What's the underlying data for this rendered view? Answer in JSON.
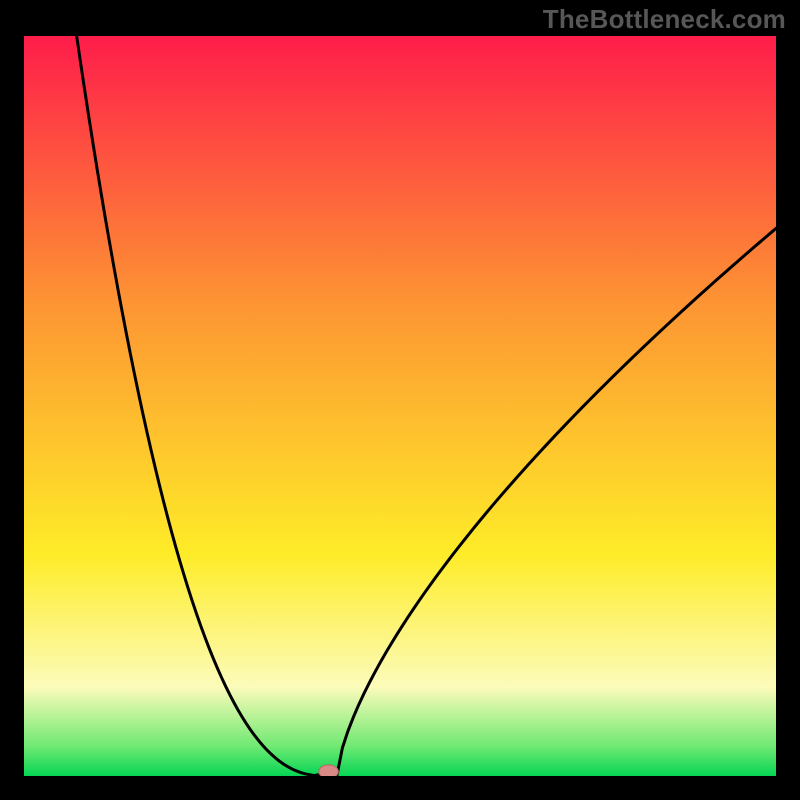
{
  "watermark": "TheBottleneck.com",
  "colors": {
    "black": "#000000",
    "curve": "#000000",
    "marker_fill": "#d98a86",
    "marker_stroke": "#b56a64",
    "grad_top": "#fe1d4a",
    "grad_mid_upper": "#fd9433",
    "grad_mid": "#feec28",
    "grad_lower": "#fcfbba",
    "grad_green_light": "#6fe972",
    "grad_green": "#06d555"
  },
  "chart_data": {
    "type": "line",
    "title": "",
    "xlabel": "",
    "ylabel": "",
    "xlim": [
      0,
      100
    ],
    "ylim": [
      0,
      100
    ],
    "curve": {
      "left_start_x": 7,
      "left_start_y": 100,
      "vertex_x": 40,
      "vertex_y": 0,
      "right_end_x": 100,
      "right_end_y": 74
    },
    "marker": {
      "x": 40.5,
      "y": 0.6,
      "rx": 1.3,
      "ry": 0.9
    },
    "annotations": [],
    "legend": []
  }
}
